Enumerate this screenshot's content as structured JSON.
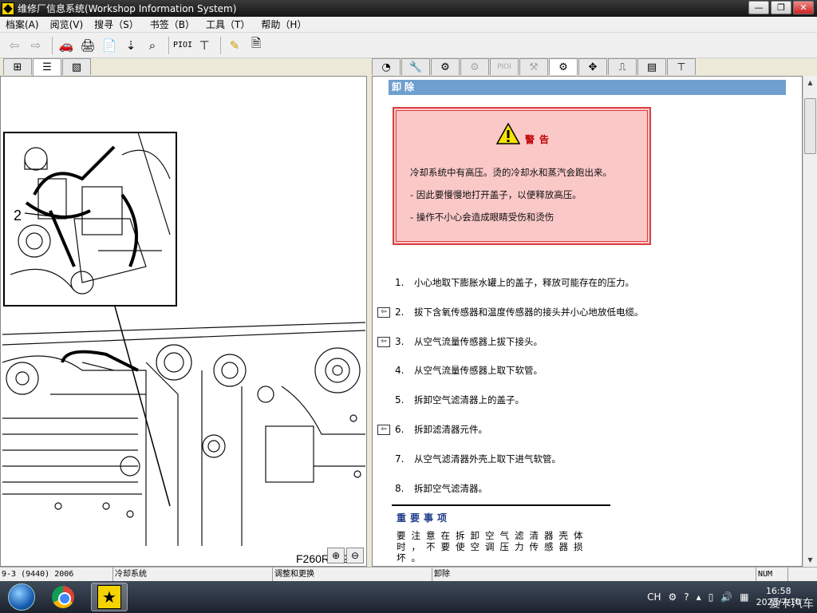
{
  "window": {
    "title": "维修厂信息系统(Workshop Information System)",
    "min": "—",
    "max": "❐",
    "close": "✕"
  },
  "menu": [
    "档案(A)",
    "阅览(V)",
    "搜寻（S）",
    "书签（B）",
    "工具（T）",
    "帮助（H）"
  ],
  "toolbar": {
    "back": "back-arrow-icon",
    "forward": "forward-arrow-icon",
    "pioi_label": "PIOI"
  },
  "right_tabs": {
    "pioi_label": "PIOI"
  },
  "figure": {
    "callout": "2",
    "label": "F260R192"
  },
  "zoom": {
    "in": "⊕",
    "out": "⊖"
  },
  "content": {
    "section_title": "卸除",
    "warning": {
      "title": "警告",
      "lines": [
        "冷却系统中有高压。烫的冷却水和蒸汽会跑出来。",
        "- 因此要慢慢地打开盖子，以便释放高压。",
        "- 操作不小心会造成眼睛受伤和烫伤"
      ]
    },
    "steps": [
      {
        "num": "1.",
        "text": "小心地取下膨胀水罐上的盖子，释放可能存在的压力。",
        "marker": false
      },
      {
        "num": "2.",
        "text": "拔下含氧传感器和温度传感器的接头并小心地放低电缆。",
        "marker": true
      },
      {
        "num": "3.",
        "text": "从空气流量传感器上拔下接头。",
        "marker": true
      },
      {
        "num": "4.",
        "text": "从空气流量传感器上取下软管。",
        "marker": false
      },
      {
        "num": "5.",
        "text": "拆卸空气滤清器上的盖子。",
        "marker": false
      },
      {
        "num": "6.",
        "text": "拆卸滤清器元件。",
        "marker": true
      },
      {
        "num": "7.",
        "text": "从空气滤清器外壳上取下进气软管。",
        "marker": false
      },
      {
        "num": "8.",
        "text": "拆卸空气滤清器。",
        "marker": false
      }
    ],
    "note": {
      "title": "重要事项",
      "text": "要注意在拆卸空气滤清器壳体时，不要使空调压力传感器损坏。"
    }
  },
  "status": {
    "model": "9-3 (9440) 2006",
    "system": "冷却系统",
    "section": "调整和更换",
    "task": "卸除",
    "num": "NUM"
  },
  "taskbar": {
    "lang": "CH",
    "time": "16:58",
    "date": "2023/7/10",
    "watermark": "爱卡汽车"
  }
}
